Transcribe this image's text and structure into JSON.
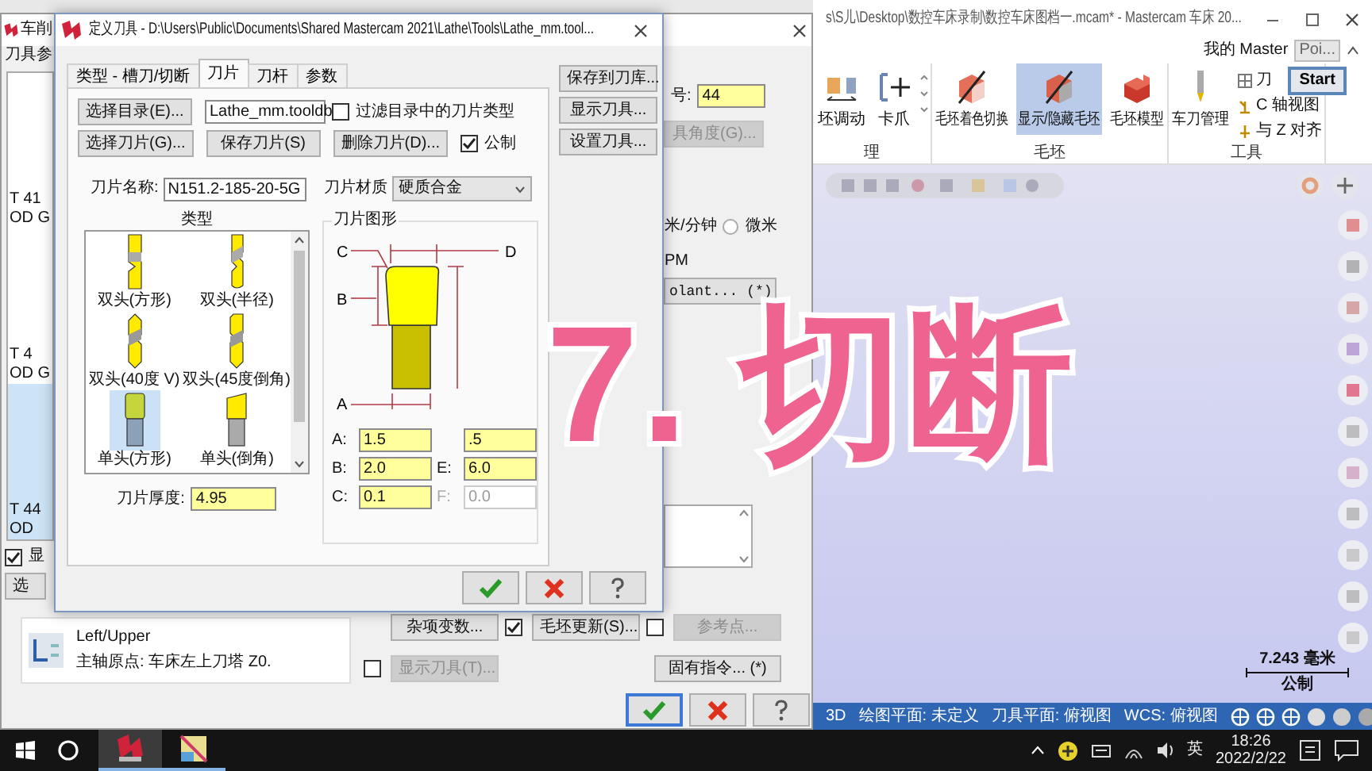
{
  "video_title": "7. 切断",
  "main_window": {
    "title": "s\\S儿\\Desktop\\数控车床录制\\数控车床图档一.mcam* - Mastercam 车床 20...",
    "account": "我的 Master",
    "tooltip": "Poi...",
    "start_button": "Start",
    "ribbon_groups": [
      {
        "label": "理",
        "items": [
          {
            "label": "坯调动",
            "selected": false
          },
          {
            "label": "卡爪",
            "selected": false
          }
        ]
      },
      {
        "label": "毛坯",
        "items": [
          {
            "label": "毛坯着色切换",
            "selected": false
          },
          {
            "label": "显示/隐藏毛坯",
            "selected": true
          },
          {
            "label": "毛坯模型",
            "selected": false
          }
        ]
      },
      {
        "label": "工具",
        "items": [
          {
            "label": "车刀管理",
            "selected": false
          }
        ],
        "small_items": [
          "刀",
          "C 轴视图",
          "与 Z 对齐"
        ]
      }
    ],
    "scale": {
      "value": "7.243 毫米",
      "unit": "公制"
    },
    "status_bar": [
      "3D",
      "绘图平面: 未定义",
      "刀具平面: 俯视图",
      "WCS: 俯视图"
    ]
  },
  "setup_dialog": {
    "title": "车削",
    "tab": "刀具参",
    "tool_list": [
      {
        "number": "T 41",
        "name": "OD G",
        "selected": false
      },
      {
        "number": "T 4",
        "name": "OD G",
        "selected": false
      },
      {
        "number": "T 44",
        "name": "OD",
        "selected": true
      }
    ],
    "show_checkbox": {
      "label": "显",
      "checked": true
    },
    "select_button": "选",
    "tool_number": {
      "label": "号:",
      "value": "44"
    },
    "angle_button": "具角度(G)...",
    "feed_unit": "米/分钟",
    "micron_radio": {
      "label": "微米",
      "selected": false
    },
    "rpm_label": "PM",
    "coolant_button": "olant... (*)",
    "axis_group": {
      "plane": "Left/Upper",
      "origin": "主轴原点: 车床左上刀塔 Z0."
    },
    "actions": [
      {
        "label": "杂项变数...",
        "enabled": true
      },
      {
        "label": "毛坯更新(S)...",
        "enabled": true,
        "checked": true
      },
      {
        "label": "参考点...",
        "enabled": false,
        "checked": false
      },
      {
        "label": "显示刀具(T)...",
        "enabled": false,
        "checked": false
      },
      {
        "label": "固有指令... (*)",
        "enabled": true
      }
    ],
    "footer_buttons": [
      {
        "kind": "ok",
        "default": true
      },
      {
        "kind": "cancel",
        "default": false
      },
      {
        "kind": "help",
        "default": false
      }
    ]
  },
  "tool_dialog": {
    "title": "定义刀具 - D:\\Users\\Public\\Documents\\Shared Mastercam 2021\\Lathe\\Tools\\Lathe_mm.tool...",
    "tabs": [
      {
        "label": "类型 - 槽刀/切断",
        "selected": false
      },
      {
        "label": "刀片",
        "selected": true
      },
      {
        "label": "刀杆",
        "selected": false
      },
      {
        "label": "参数",
        "selected": false
      }
    ],
    "side_buttons": [
      "保存到刀库...",
      "显示刀具...",
      "设置刀具..."
    ],
    "catalog_button": "选择目录(E)...",
    "catalog_file": "Lathe_mm.tooldb",
    "filter_checkbox": {
      "label": "过滤目录中的刀片类型",
      "checked": false
    },
    "insert_buttons": [
      "选择刀片(G)...",
      "保存刀片(S)",
      "删除刀片(D)..."
    ],
    "metric_checkbox": {
      "label": "公制",
      "checked": true
    },
    "insert_name": {
      "label": "刀片名称:",
      "value": "N151.2-185-20-5G"
    },
    "material": {
      "label": "刀片材质",
      "value": "硬质合金"
    },
    "style_label": "类型",
    "styles": [
      {
        "label": "双头(方形)",
        "selected": false
      },
      {
        "label": "双头(半径)",
        "selected": false
      },
      {
        "label": "双头(40度 V)",
        "selected": false
      },
      {
        "label": "双头(45度倒角)",
        "selected": false
      },
      {
        "label": "单头(方形)",
        "selected": true
      },
      {
        "label": "单头(倒角)",
        "selected": false
      }
    ],
    "thickness": {
      "label": "刀片厚度:",
      "value": "4.95"
    },
    "geometry": {
      "title": "刀片图形",
      "dimension_labels": [
        "C",
        "D",
        "B",
        "A"
      ],
      "fields": [
        {
          "label": "A:",
          "value": "1.5",
          "disabled": false
        },
        {
          "value": ".5",
          "disabled": false
        },
        {
          "label": "B:",
          "value": "2.0",
          "disabled": false
        },
        {
          "label": "E:",
          "value": "6.0",
          "disabled": false
        },
        {
          "label": "C:",
          "value": "0.1",
          "disabled": false
        },
        {
          "label": "F:",
          "value": "0.0",
          "disabled": true
        }
      ]
    },
    "footer_buttons": [
      {
        "kind": "ok"
      },
      {
        "kind": "cancel"
      },
      {
        "kind": "help"
      }
    ]
  },
  "taskbar": {
    "apps": [
      {
        "active": true
      },
      {
        "active": false
      }
    ],
    "ime": "英",
    "time": "18:26",
    "date": "2022/2/22"
  }
}
